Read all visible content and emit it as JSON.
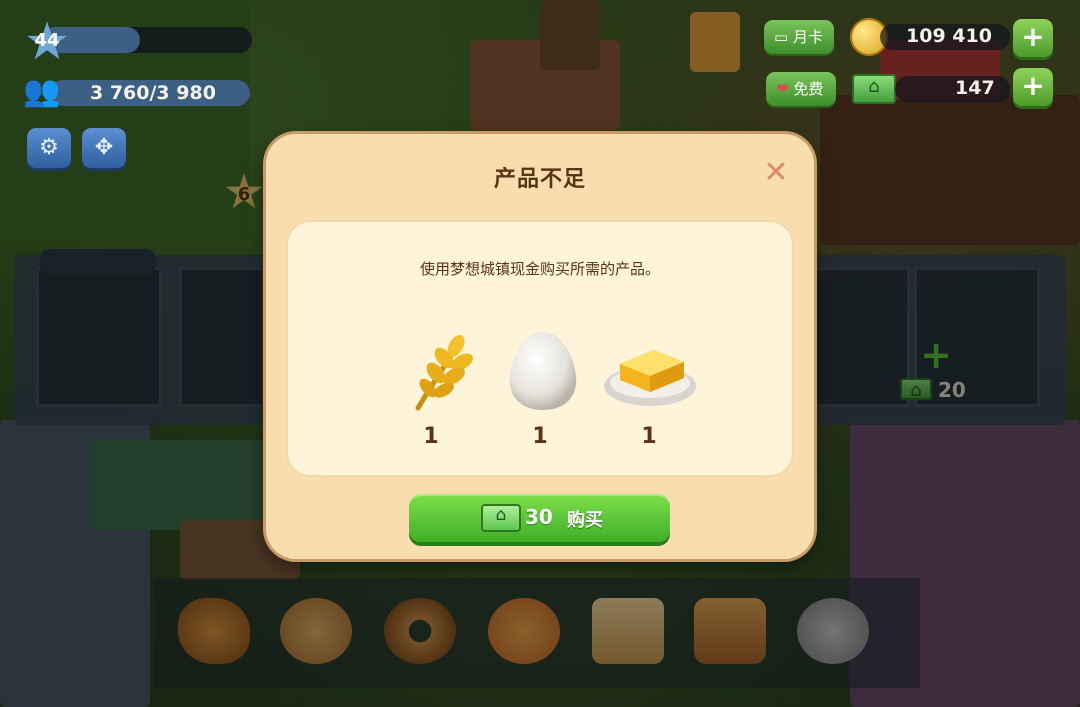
{
  "hud": {
    "level": "44",
    "population": "3 760/3 980",
    "monthly_card_label": "月卡",
    "free_label": "免费",
    "coins": "109 410",
    "cash": "147"
  },
  "background": {
    "locked_star_level": "6",
    "storage_slot_cash": "20"
  },
  "dialog": {
    "title": "产品不足",
    "message": "使用梦想城镇现金购买所需的产品。",
    "items": [
      {
        "icon": "wheat-icon",
        "qty": "1"
      },
      {
        "icon": "egg-icon",
        "qty": "1"
      },
      {
        "icon": "butter-icon",
        "qty": "1"
      }
    ],
    "buy_button": {
      "amount": "30",
      "label": "购买"
    }
  },
  "product_bar": {
    "items": [
      "bread-icon",
      "cookie-icon",
      "donut-icon",
      "pizza-icon",
      "toast-icon",
      "loaf-icon",
      "plate-icon"
    ]
  },
  "colors": {
    "dialog_bg": "#f9ddae",
    "dialog_inner": "#fdf4d9",
    "title_text": "#5b3417",
    "buy_button": "#4fc12f"
  }
}
